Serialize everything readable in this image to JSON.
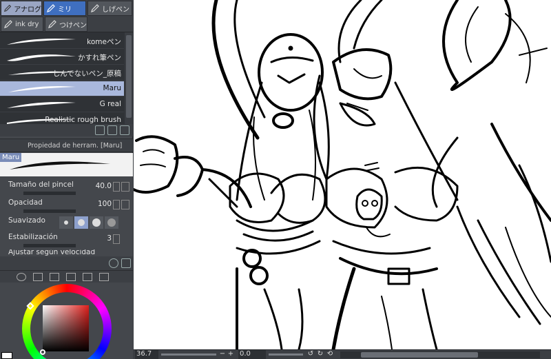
{
  "tool_tabs": [
    {
      "label": "アナログ",
      "icon": "pencil-icon",
      "active": true
    },
    {
      "label": "ミリ",
      "icon": "pen-icon",
      "active": true
    },
    {
      "label": "しげペン",
      "icon": "pen-icon",
      "active": false
    },
    {
      "label": "ink dry",
      "icon": "pen-icon",
      "active": false
    },
    {
      "label": "つけペン",
      "icon": "pen-icon",
      "active": false
    }
  ],
  "brushes": [
    {
      "name": "komeペン"
    },
    {
      "name": "かすれ筆ペン"
    },
    {
      "name": "しんでないペン_原稿"
    },
    {
      "name": "Maru",
      "selected": true
    },
    {
      "name": "G real"
    },
    {
      "name": "Realistic rough brush"
    }
  ],
  "tool_property": {
    "title": "Propiedad de herram. [Maru]",
    "brush_name": "Maru",
    "size_label": "Tamaño del pincel",
    "size_value": "40.0",
    "opacity_label": "Opacidad",
    "opacity_value": "100",
    "smoothing_label": "Suavizado",
    "stabilization_label": "Estabilización",
    "stabilization_value": "3",
    "next_label": "Ajustar según velocidad"
  },
  "status": {
    "zoom": "36.7",
    "angle": "0.0"
  },
  "colors": {
    "accent_selected": "#a9b8dc",
    "tab_active": "#3f6fc0",
    "foreground": "#ffffff",
    "current_hue": "#e0201c"
  }
}
